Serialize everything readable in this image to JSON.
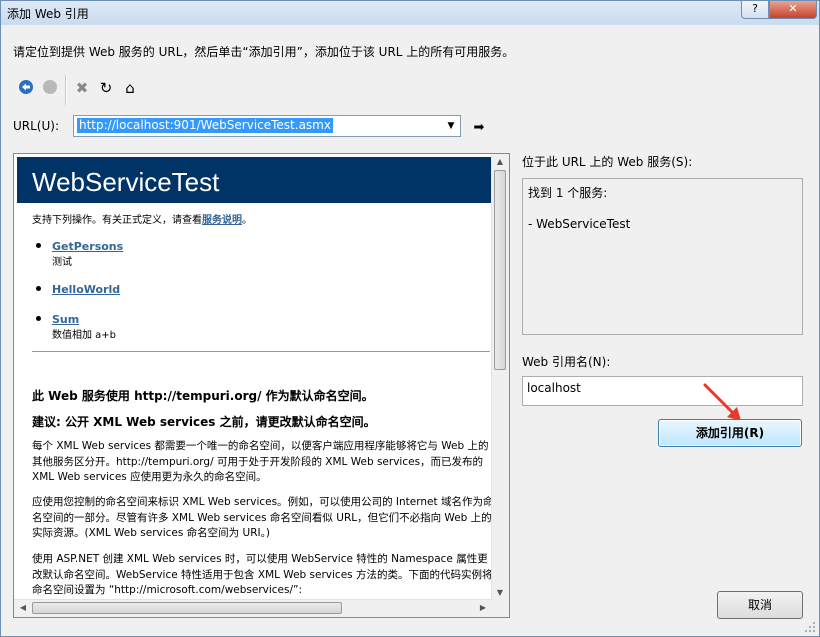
{
  "window": {
    "title": "添加 Web 引用",
    "help_glyph": "?",
    "close_glyph": "✕"
  },
  "instruction": "请定位到提供 Web 服务的 URL，然后单击“添加引用”，添加位于该 URL 上的所有可用服务。",
  "toolbar": {
    "icons": [
      "back-icon",
      "stop-icon",
      "cancel-icon",
      "refresh-icon",
      "home-icon"
    ]
  },
  "url": {
    "label": "URL(U):",
    "value": "http://localhost:901/WebServiceTest.asmx"
  },
  "browser": {
    "banner_title": "WebServiceTest",
    "intro_prefix": "支持下列操作。有关正式定义，请查看",
    "intro_link": "服务说明",
    "intro_suffix": "。",
    "operations": [
      {
        "name": "GetPersons",
        "desc": "测试"
      },
      {
        "name": "HelloWorld",
        "desc": ""
      },
      {
        "name": "Sum",
        "desc": "数值相加 a+b"
      }
    ],
    "notice1": "此 Web 服务使用 http://tempuri.org/ 作为默认命名空间。",
    "notice2": "建议: 公开 XML Web services 之前，请更改默认命名空间。",
    "para1": "每个 XML Web services 都需要一个唯一的命名空间，以便客户端应用程序能够将它与 Web 上的其他服务区分开。http://tempuri.org/ 可用于处于开发阶段的 XML Web services，而已发布的 XML Web services 应使用更为永久的命名空间。",
    "para2": "应使用您控制的命名空间来标识 XML Web services。例如，可以使用公司的 Internet 域名作为命名空间的一部分。尽管有许多 XML Web services 命名空间看似 URL，但它们不必指向 Web 上的实际资源。(XML Web services 命名空间为 URI。)",
    "para3": "使用 ASP.NET 创建 XML Web services 时，可以使用 WebService 特性的 Namespace 属性更改默认命名空间。WebService 特性适用于包含 XML Web services 方法的类。下面的代码实例将命名空间设置为 “http://microsoft.com/webservices/”:"
  },
  "services": {
    "label": "位于此 URL 上的 Web 服务(S):",
    "found": "找到 1 个服务:",
    "items": [
      "- WebServiceTest"
    ]
  },
  "reference": {
    "label": "Web 引用名(N):",
    "value": "localhost"
  },
  "buttons": {
    "add": "添加引用(R)",
    "cancel": "取消"
  },
  "colors": {
    "banner": "#003366",
    "link": "#336699",
    "selection": "#3399ff",
    "annotation_arrow": "#e8392b"
  }
}
